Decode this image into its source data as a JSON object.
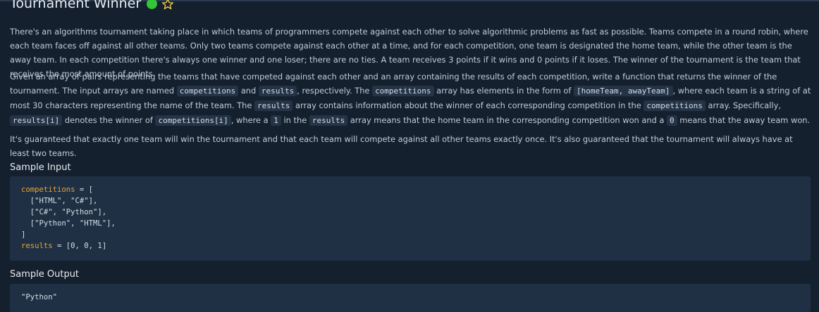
{
  "problem": {
    "title": "Tournament Winner",
    "status_color": "#34c43a",
    "star_icon": "star-outline-icon"
  },
  "description": {
    "p1": "There's an algorithms tournament taking place in which teams of programmers compete against each other to solve algorithmic problems as fast as possible. Teams compete in a round robin, where each team faces off against all other teams. Only two teams compete against each other at a time, and for each competition, one team is designated the home team, while the other team is the away team. In each competition there's always one winner and one loser; there are no ties. A team receives 3 points if it wins and 0 points if it loses. The winner of the tournament is the team that receives the most amount of points.",
    "p2": {
      "t1": "Given an array of pairs representing the teams that have competed against each other and an array containing the results of each competition, write a function that returns the winner of the tournament. The input arrays are named ",
      "c1": "competitions",
      "t2": " and ",
      "c2": "results",
      "t3": ", respectively. The ",
      "c3": "competitions",
      "t4": " array has elements in the form of ",
      "c4": "[homeTeam, awayTeam]",
      "t5": ", where each team is a string of at most 30 characters representing the name of the team. The ",
      "c5": "results",
      "t6": " array contains information about the winner of each corresponding competition in the ",
      "c6": "competitions",
      "t7": " array. Specifically, ",
      "c7": "results[i]",
      "t8": " denotes the winner of ",
      "c8": "competitions[i]",
      "t9": ", where a ",
      "c9": "1",
      "t10": " in the ",
      "c10": "results",
      "t11": " array means that the home team in the corresponding competition won and a ",
      "c11": "0",
      "t12": " means that the away team won."
    },
    "p3": "It's guaranteed that exactly one team will win the tournament and that each team will compete against all other teams exactly once. It's also guaranteed that the tournament will always have at least two teams."
  },
  "sample_input": {
    "heading": "Sample Input",
    "var1": "competitions",
    "line1_rest": " = [",
    "line2": "  [\"HTML\", \"C#\"],",
    "line3": "  [\"C#\", \"Python\"],",
    "line4": "  [\"Python\", \"HTML\"],",
    "line5": "]",
    "var2": "results",
    "line6_rest": " = [0, 0, 1]"
  },
  "sample_output": {
    "heading": "Sample Output",
    "value": "\"Python\""
  }
}
